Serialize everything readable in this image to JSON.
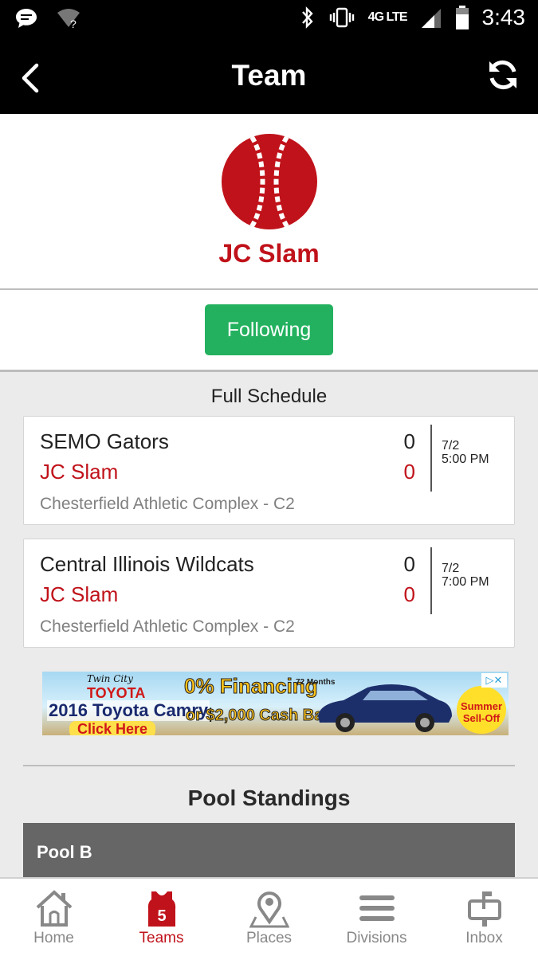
{
  "status_bar": {
    "time": "3:43",
    "network": "4G LTE",
    "icons": [
      "chat-bubble-icon",
      "wifi-unknown-icon",
      "bluetooth-icon",
      "vibrate-icon",
      "signal-icon",
      "battery-icon"
    ]
  },
  "app_bar": {
    "title": "Team",
    "back_icon": "chevron-left-icon",
    "refresh_icon": "refresh-icon"
  },
  "team": {
    "name": "JC Slam",
    "logo_icon": "baseball-icon",
    "follow_label": "Following"
  },
  "schedule": {
    "title": "Full Schedule",
    "games": [
      {
        "away_team": "SEMO Gators",
        "away_score": "0",
        "home_team": "JC Slam",
        "home_score": "0",
        "date": "7/2",
        "time": "5:00 PM",
        "venue": "Chesterfield Athletic Complex - C2"
      },
      {
        "away_team": "Central Illinois Wildcats",
        "away_score": "0",
        "home_team": "JC Slam",
        "home_score": "0",
        "date": "7/2",
        "time": "7:00 PM",
        "venue": "Chesterfield Athletic Complex - C2"
      }
    ]
  },
  "ad": {
    "dealer": "Twin City",
    "brand": "TOYOTA",
    "model": "2016 Toyota Camry",
    "financing": "0% Financing",
    "months": "72 Months",
    "cash": "or $2,000 Cash Back",
    "cta": "Click Here",
    "badge": "Summer Sell-Off"
  },
  "standings": {
    "title": "Pool Standings",
    "pool": "Pool B"
  },
  "bottom_nav": {
    "items": [
      {
        "label": "Home",
        "icon": "home-icon"
      },
      {
        "label": "Teams",
        "icon": "jersey-icon",
        "badge": "5"
      },
      {
        "label": "Places",
        "icon": "map-pin-icon"
      },
      {
        "label": "Divisions",
        "icon": "menu-icon"
      },
      {
        "label": "Inbox",
        "icon": "mailbox-icon"
      }
    ],
    "active": "Teams"
  },
  "colors": {
    "brand_red": "#c0121a",
    "follow_green": "#23b15f",
    "app_bar": "#000000",
    "pool_header": "#666666"
  }
}
